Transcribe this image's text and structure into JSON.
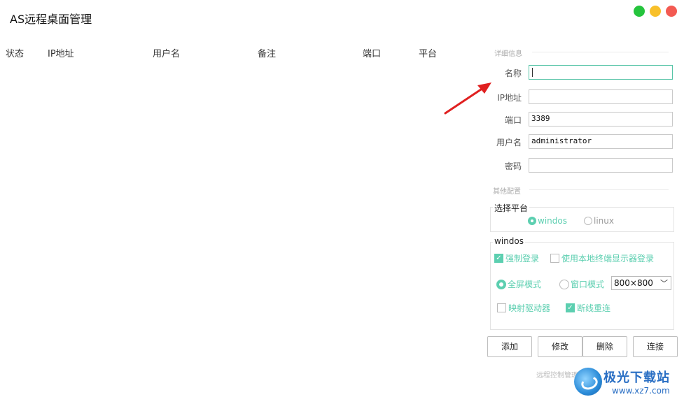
{
  "window": {
    "title": "AS远程桌面管理"
  },
  "table": {
    "columns": [
      "状态",
      "IP地址",
      "用户名",
      "备注",
      "端口",
      "平台"
    ],
    "rows": []
  },
  "details": {
    "section_title": "详细信息",
    "name_label": "名称",
    "name_value": "",
    "ip_label": "IP地址",
    "ip_value": "",
    "port_label": "端口",
    "port_value": "3389",
    "user_label": "用户名",
    "user_value": "administrator",
    "password_label": "密码",
    "password_value": ""
  },
  "other": {
    "section_title": "其他配置",
    "platform_group_title": "选择平台",
    "platform_options": [
      "windos",
      "linux"
    ],
    "platform_selected": "windos",
    "windos_group_title": "windos",
    "force_login_label": "强制登录",
    "force_login_checked": true,
    "local_display_label": "使用本地终端显示器登录",
    "local_display_checked": false,
    "fullscreen_label": "全屏模式",
    "window_mode_label": "窗口模式",
    "screen_mode_selected": "全屏模式",
    "resolution_value": "800×800",
    "map_drives_label": "映射驱动器",
    "map_drives_checked": false,
    "reconnect_label": "断线重连",
    "reconnect_checked": true
  },
  "buttons": {
    "add": "添加",
    "edit": "修改",
    "delete": "删除",
    "connect": "连接"
  },
  "footer": {
    "text": "远程控制管理器"
  },
  "watermark": {
    "title": "极光下载站",
    "url": "www.xz7.com"
  },
  "colors": {
    "accent": "#5ccfb0",
    "annotation_arrow": "#e02020",
    "close": "#f35a52",
    "minimize": "#f8c02a",
    "maximize": "#25c43d"
  }
}
